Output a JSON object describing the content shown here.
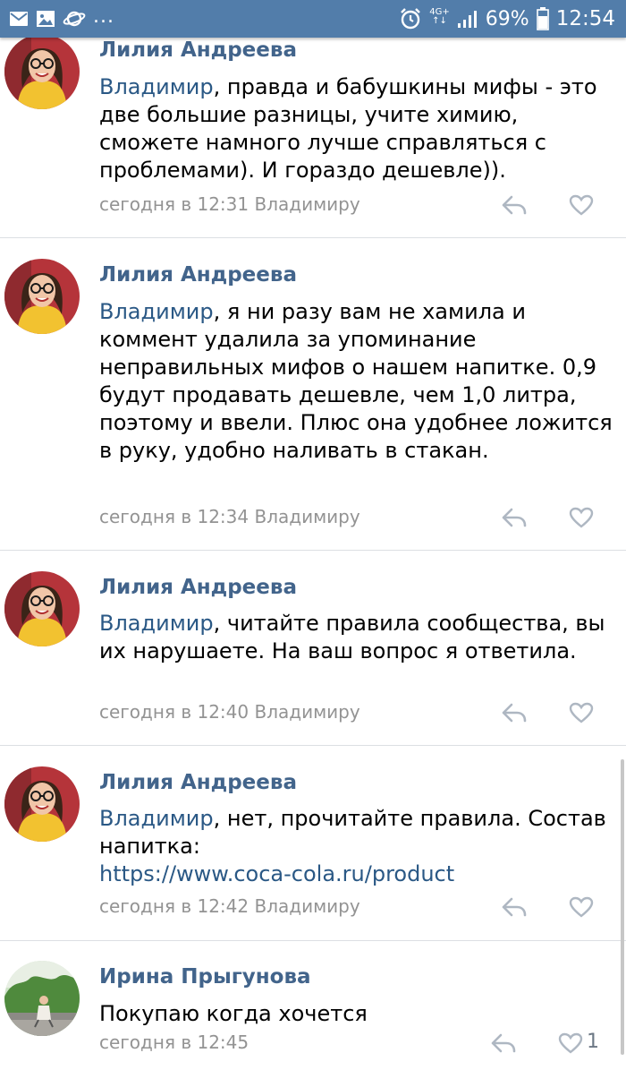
{
  "status_bar": {
    "network_top": "4G+",
    "network_bottom": "↑↓",
    "battery": "69%",
    "time": "12:54",
    "ellipsis": "..."
  },
  "comments": [
    {
      "author": "Лилия Андреева",
      "mention": "Владимир",
      "text": ", правда и бабушкины мифы - это две большие разницы, учите химию, сможете намного лучше справляться с проблемами). И гораздо дешевле)).",
      "meta": "сегодня в 12:31 Владимиру",
      "likes": ""
    },
    {
      "author": "Лилия Андреева",
      "mention": "Владимир",
      "text": ", я ни разу вам не хамила и коммент удалила за упоминание неправильных мифов о нашем напитке. 0,9 будут продавать дешевле, чем 1,0 литра, поэтому и ввели. Плюс она удобнее ложится в руку, удобно наливать в стакан.",
      "meta": "сегодня в 12:34 Владимиру",
      "likes": ""
    },
    {
      "author": "Лилия Андреева",
      "mention": "Владимир",
      "text": ", читайте правила сообщества, вы их нарушаете. На ваш вопрос я ответила.",
      "meta": "сегодня в 12:40 Владимиру",
      "likes": ""
    },
    {
      "author": "Лилия Андреева",
      "mention": "Владимир",
      "text": ", нет, прочитайте правила. Состав напитка:",
      "link": "https://www.coca-cola.ru/product",
      "meta": "сегодня в 12:42 Владимиру",
      "likes": ""
    },
    {
      "author": "Ирина Прыгунова",
      "text": "Покупаю когда хочется",
      "meta": "сегодня в 12:45",
      "likes": "1"
    }
  ],
  "colors": {
    "status_bar": "#527daa",
    "author": "#42648b",
    "link": "#2a5885",
    "meta": "#939393",
    "divider": "#dcdfe3"
  }
}
